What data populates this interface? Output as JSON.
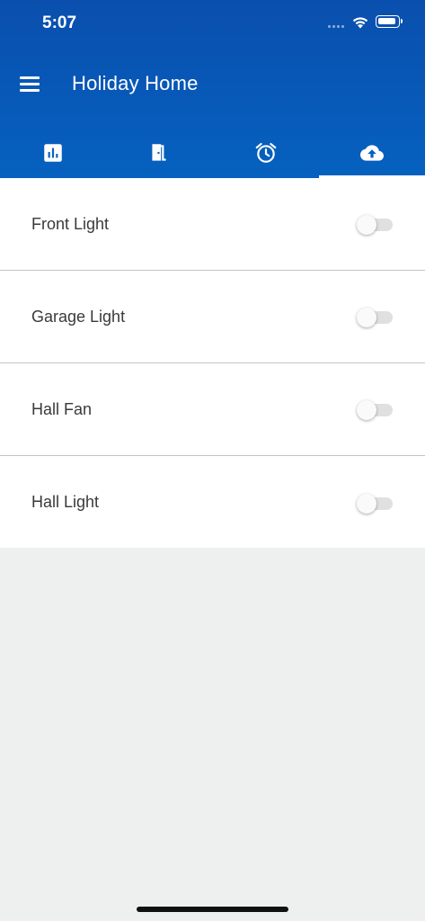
{
  "status_bar": {
    "time": "5:07",
    "icons": [
      "signal-dots-icon",
      "wifi-icon",
      "battery-icon"
    ]
  },
  "app_bar": {
    "title": "Holiday Home",
    "menu_icon": "menu-icon"
  },
  "tabs": [
    {
      "icon": "bar-chart-icon",
      "active": false
    },
    {
      "icon": "door-icon",
      "active": false
    },
    {
      "icon": "alarm-clock-icon",
      "active": false
    },
    {
      "icon": "cloud-upload-icon",
      "active": true
    }
  ],
  "devices": [
    {
      "label": "Front Light",
      "on": false
    },
    {
      "label": "Garage Light",
      "on": false
    },
    {
      "label": "Hall Fan",
      "on": false
    },
    {
      "label": "Hall Light",
      "on": false
    }
  ],
  "colors": {
    "header_top": "#0a4fae",
    "header_bottom": "#0661bf",
    "background": "#eeefef",
    "list_background": "#ffffff",
    "switch_track_off": "#e0e0e0"
  }
}
